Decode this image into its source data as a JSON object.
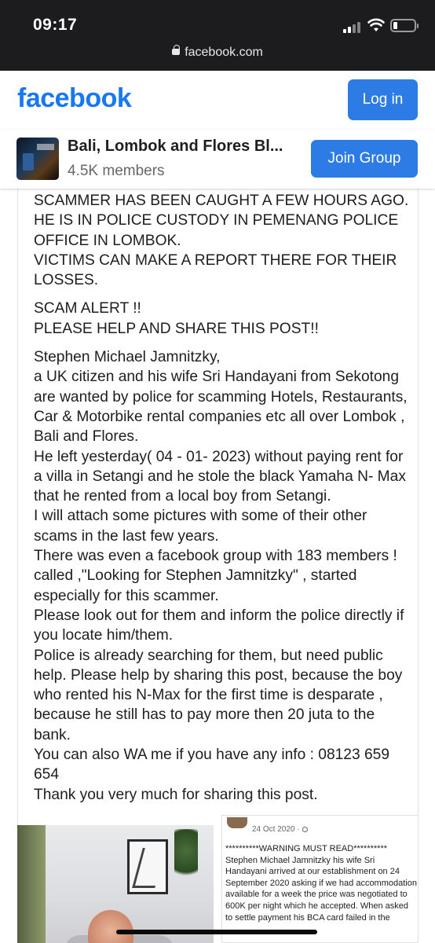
{
  "status_bar": {
    "time": "09:17",
    "url": "facebook.com",
    "battery_percent": 15
  },
  "header": {
    "logo": "facebook",
    "login_label": "Log in",
    "brand_color": "#1877f2",
    "button_color": "#2d7be5"
  },
  "group": {
    "name": "Bali, Lombok and Flores Bl...",
    "members": "4.5K members",
    "join_label": "Join Group"
  },
  "post": {
    "paragraphs": [
      "SCAMMER HAS BEEN CAUGHT A FEW HOURS AGO. HE IS IN POLICE CUSTODY IN PEMENANG POLICE OFFICE IN LOMBOK.\nVICTIMS CAN MAKE A  REPORT THERE FOR THEIR LOSSES.",
      "SCAM ALERT !!\nPLEASE HELP AND  SHARE THIS POST!!",
      "Stephen Michael Jamnitzky,\na UK citizen and his wife Sri Handayani from Sekotong are wanted by police for scamming Hotels, Restaurants, Car & Motorbike rental companies etc all over Lombok , Bali and Flores.\nHe left yesterday( 04 - 01- 2023) without paying rent for a villa in Setangi and he stole the black Yamaha N- Max that he rented from a local boy from Setangi.\nI will attach some pictures with some of their other scams in the last few years.\nThere was even a facebook group with 183 members ! called ,\"Looking for Stephen Jamnitzky\" , started  especially for this scammer.\nPlease look out for them and inform the police directly if you locate him/them.\nPolice is already searching for them, but need public help. Please help by sharing this post, because the boy who rented his N-Max for the first time is desparate , because he still has to pay more then 20 juta to the bank.\nYou can also WA me if you have any info :  08123 659 654\nThank you very much for sharing this post."
    ]
  },
  "attachment": {
    "date": "24 Oct 2020 ·",
    "text": "**********WARNING MUST READ**********\nStephen Michael Jamnitzky his wife Sri Handayani arrived at our establishment on 24 September 2020 asking if we had accommodation available for a week the price was negotiated to 600K per night which he accepted. When asked to settle payment his BCA card failed in the"
  }
}
